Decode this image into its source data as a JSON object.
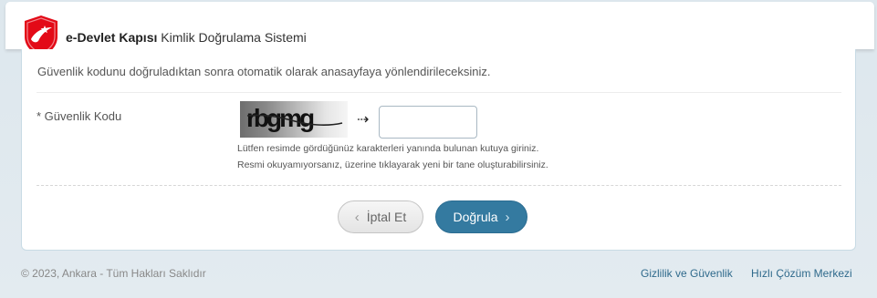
{
  "header": {
    "brand": "e-Devlet Kapısı",
    "subtitle": " Kimlik Doğrulama Sistemi",
    "logo_icon": "edevlet-shield-logo"
  },
  "main": {
    "info_text": "Güvenlik kodunu doğruladıktan sonra otomatik olarak anasayfaya yönlendirileceksiniz.",
    "field_label": "* Güvenlik Kodu",
    "captcha_text": "rbgmg",
    "arrow_icon": "arrow-right-icon",
    "code_input": {
      "value": "",
      "placeholder": ""
    },
    "hint_line1": "Lütfen resimde gördüğünüz karakterleri yanında bulunan kutuya giriniz.",
    "hint_line2": "Resmi okuyamıyorsanız, üzerine tıklayarak yeni bir tane oluşturabilirsiniz.",
    "cancel_label": "İptal Et",
    "submit_label": "Doğrula"
  },
  "footer": {
    "copyright": "© 2023, Ankara - Tüm Hakları Saklıdır",
    "privacy_link": "Gizlilik ve Güvenlik",
    "help_link": "Hızlı Çözüm Merkezi"
  },
  "colors": {
    "accent": "#347aa0",
    "logo_red": "#e30a17",
    "link": "#2f6a8c"
  }
}
